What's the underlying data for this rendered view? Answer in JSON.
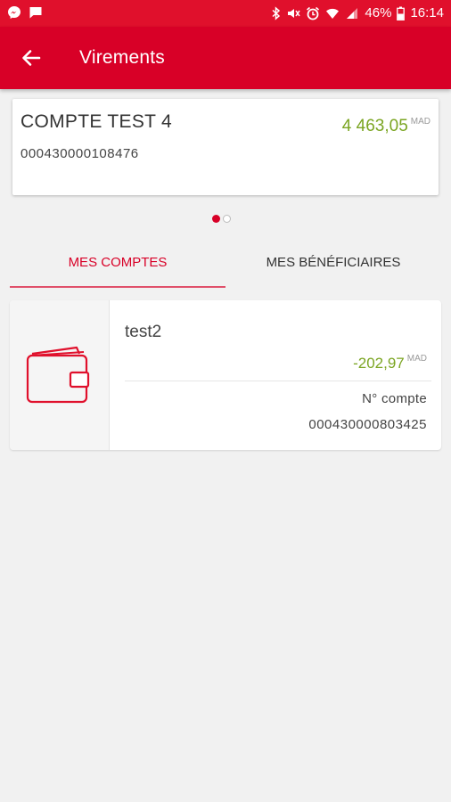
{
  "status_bar": {
    "battery_text": "46%",
    "time": "16:14",
    "left_icons": [
      "messenger-icon",
      "message-icon"
    ],
    "right_icons": [
      "bluetooth-icon",
      "mute-icon",
      "alarm-icon",
      "wifi-icon",
      "signal-icon",
      "battery-icon"
    ]
  },
  "app_bar": {
    "title": "Virements",
    "back_icon": "arrow-left-icon",
    "color": "#d80027"
  },
  "account_card": {
    "name": "COMPTE TEST 4",
    "number": "000430000108476",
    "balance": "4 463,05",
    "currency": "MAD",
    "balance_color": "#7ba522"
  },
  "pager": {
    "total": 2,
    "active_index": 0
  },
  "tabs": [
    {
      "label": "MES COMPTES",
      "active": true
    },
    {
      "label": "MES BÉNÉFICIAIRES",
      "active": false
    }
  ],
  "accounts_list": [
    {
      "icon": "wallet-icon",
      "name": "test2",
      "balance": "-202,97",
      "currency": "MAD",
      "account_number_label": "N° compte",
      "account_number": "000430000803425"
    }
  ]
}
